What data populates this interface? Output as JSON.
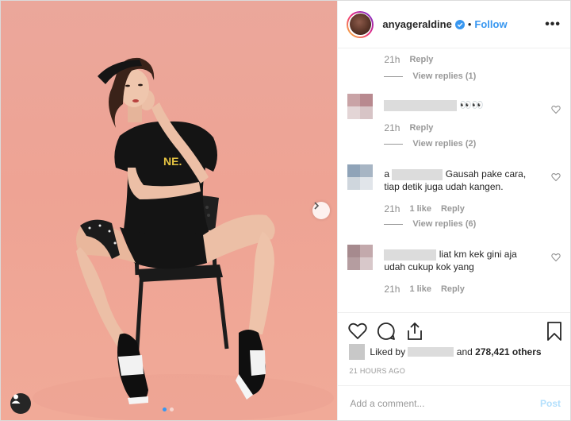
{
  "post": {
    "dots_active_index": 0,
    "dots_count": 2
  },
  "header": {
    "username": "anyageraldine",
    "separator": "•",
    "follow_label": "Follow",
    "more_label": "•••",
    "accent_color": "#3897f0"
  },
  "comments": [
    {
      "id": "top",
      "time": "21h",
      "reply_label": "Reply",
      "view_replies_label": "View replies (1)"
    },
    {
      "id": "c1",
      "text": "",
      "emoji": "👀👀",
      "time": "21h",
      "reply_label": "Reply",
      "view_replies_label": "View replies (2)"
    },
    {
      "id": "c2",
      "prefix": "a",
      "text_line1": "Gausah pake cara,",
      "text_line2": "tiap detik juga udah kangen.",
      "time": "21h",
      "likes_label": "1 like",
      "reply_label": "Reply",
      "view_replies_label": "View replies (6)"
    },
    {
      "id": "c3",
      "text_line1": "liat km kek gini aja",
      "text_line2": "udah cukup kok yang",
      "time": "21h",
      "likes_label": "1 like",
      "reply_label": "Reply"
    }
  ],
  "actions": {
    "liked_by_prefix": "Liked by",
    "liked_by_and": "and",
    "others_count": "278,421 others",
    "time_ago": "21 HOURS AGO"
  },
  "add_comment": {
    "placeholder": "Add a comment...",
    "post_label": "Post"
  }
}
